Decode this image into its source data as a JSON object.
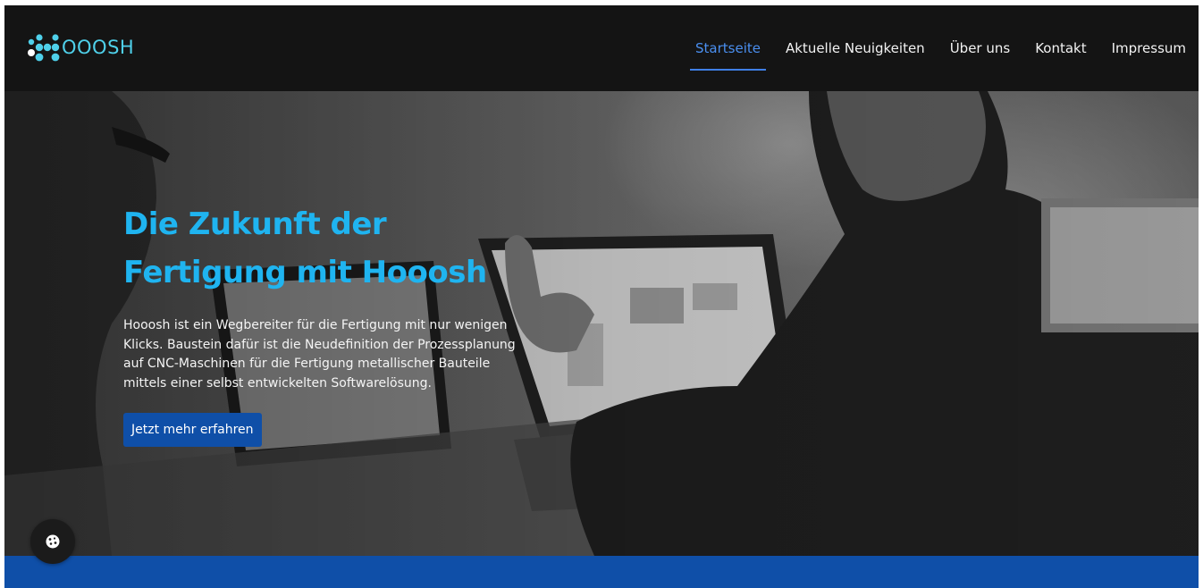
{
  "header": {
    "logo_text": "OOOSH",
    "nav": [
      {
        "label": "Startseite",
        "active": true
      },
      {
        "label": "Aktuelle Neuigkeiten",
        "active": false
      },
      {
        "label": "Über uns",
        "active": false
      },
      {
        "label": "Kontakt",
        "active": false
      },
      {
        "label": "Impressum",
        "active": false
      }
    ]
  },
  "hero": {
    "title_line1": "Die Zukunft der",
    "title_line2": "Fertigung mit Hooosh",
    "text": "Hooosh ist ein Wegbereiter für die Fertigung mit nur wenigen Klicks. Baustein dafür ist die Neudefinition der Prozessplanung auf CNC-Maschinen für die Fertigung metallischer Bauteile mittels einer selbst entwickelten Softwarelösung.",
    "cta_label": "Jetzt mehr erfahren"
  },
  "cookie_button": {
    "icon": "cookie-icon"
  },
  "colors": {
    "accent_blue": "#1fb4f0",
    "brand_blue": "#0f4fa8",
    "nav_active": "#4a8ff0",
    "logo": "#4fd0ea",
    "header_bg": "#141414"
  }
}
